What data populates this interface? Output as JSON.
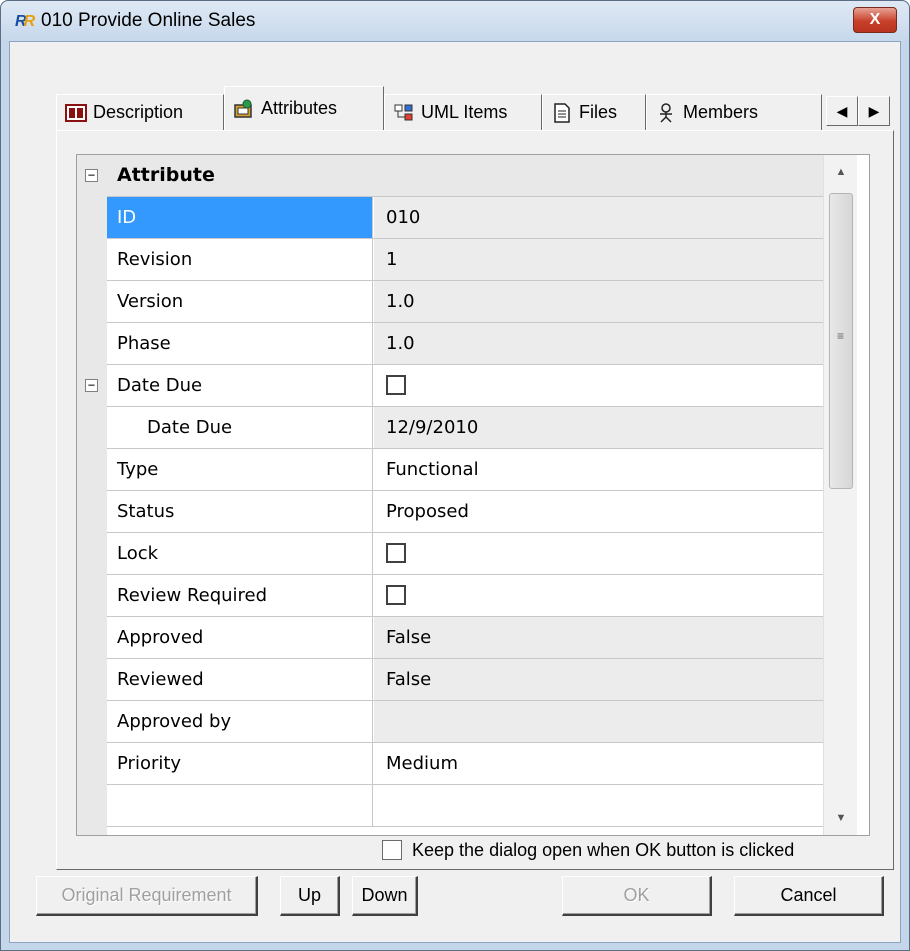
{
  "window": {
    "title": "010 Provide Online Sales",
    "close_glyph": "X"
  },
  "tabs": [
    {
      "label": "Description",
      "icon": "description-icon",
      "active": false
    },
    {
      "label": "Attributes",
      "icon": "attributes-icon",
      "active": true
    },
    {
      "label": "UML Items",
      "icon": "uml-items-icon",
      "active": false
    },
    {
      "label": "Files",
      "icon": "files-icon",
      "active": false
    },
    {
      "label": "Members",
      "icon": "members-icon",
      "active": false
    }
  ],
  "tab_scroll": {
    "left": "◀",
    "right": "▶"
  },
  "grid": {
    "category": "Attribute",
    "rows": [
      {
        "name": "ID",
        "value": "010",
        "kind": "text",
        "selected": true,
        "readonly": true
      },
      {
        "name": "Revision",
        "value": "1",
        "kind": "text",
        "readonly": true
      },
      {
        "name": "Version",
        "value": "1.0",
        "kind": "text",
        "readonly": true
      },
      {
        "name": "Phase",
        "value": "1.0",
        "kind": "text",
        "readonly": true
      },
      {
        "name": "Date Due",
        "value": "",
        "kind": "checkbox",
        "checked": false,
        "expandable": true
      },
      {
        "name": "Date Due",
        "value": "12/9/2010",
        "kind": "text",
        "child": true,
        "readonly": true
      },
      {
        "name": "Type",
        "value": "Functional",
        "kind": "text"
      },
      {
        "name": "Status",
        "value": "Proposed",
        "kind": "text"
      },
      {
        "name": "Lock",
        "value": "",
        "kind": "checkbox",
        "checked": false
      },
      {
        "name": "Review Required",
        "value": "",
        "kind": "checkbox",
        "checked": false
      },
      {
        "name": "Approved",
        "value": "False",
        "kind": "text",
        "readonly": true
      },
      {
        "name": "Reviewed",
        "value": "False",
        "kind": "text",
        "readonly": true
      },
      {
        "name": "Approved by",
        "value": "",
        "kind": "text",
        "readonly": true
      },
      {
        "name": "Priority",
        "value": "Medium",
        "kind": "text"
      },
      {
        "name": "",
        "value": "",
        "kind": "text"
      }
    ]
  },
  "keep_open": {
    "label": "Keep the dialog open when OK button is clicked",
    "checked": false
  },
  "buttons": {
    "original_requirement": "Original Requirement",
    "up": "Up",
    "down": "Down",
    "ok": "OK",
    "cancel": "Cancel"
  },
  "colors": {
    "selection": "#3399ff",
    "frame": "#c3d6ea",
    "close": "#c8412a"
  }
}
